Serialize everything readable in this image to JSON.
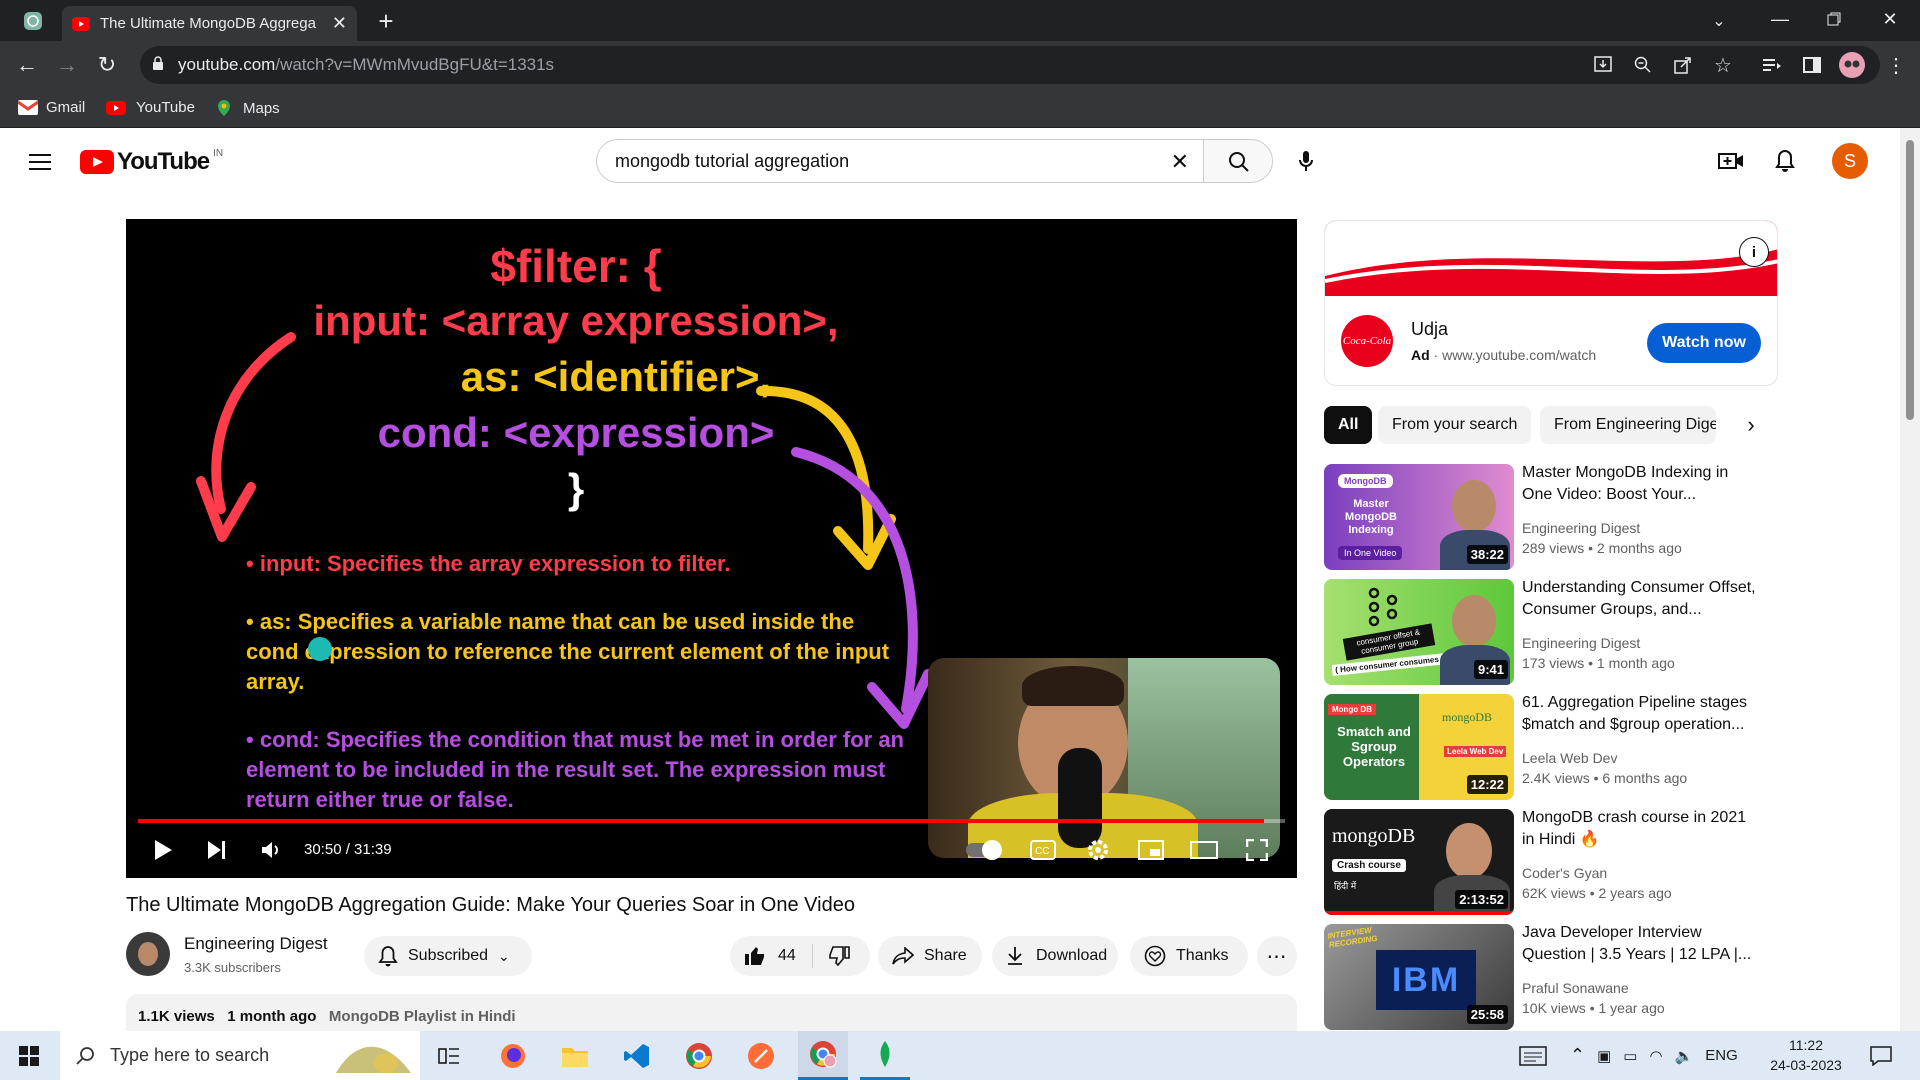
{
  "browser": {
    "tab_title": "The Ultimate MongoDB Aggrega",
    "url_host": "youtube.com",
    "url_path": "/watch?v=MWmMvudBgFU&t=1331s",
    "bookmarks": [
      "Gmail",
      "YouTube",
      "Maps"
    ]
  },
  "youtube": {
    "logo": "YouTube",
    "region": "IN",
    "search_query": "mongodb tutorial aggregation",
    "avatar_letter": "S"
  },
  "player": {
    "slide_title": "$filter: {",
    "slide_lines": [
      "input: <array expression>,",
      "as: <identifier>,",
      "cond: <expression>",
      "}"
    ],
    "bullet1": "input: Specifies the array expression to filter.",
    "bullet2": "as: Specifies a variable name that can be used inside the cond expression to reference the current element of the input array.",
    "bullet3": "cond: Specifies the condition that must be met in order for an element to be included in the result set. The expression must return either true or false.",
    "time": "30:50 / 31:39",
    "progress": 0.982
  },
  "video": {
    "title": "The Ultimate MongoDB Aggregation Guide: Make Your Queries Soar in One Video",
    "channel": "Engineering Digest",
    "subscribers": "3.3K subscribers",
    "subscribed_label": "Subscribed",
    "likes": "44",
    "share": "Share",
    "download": "Download",
    "thanks": "Thanks",
    "views": "1.1K views",
    "age": "1 month ago",
    "playlist": "MongoDB Playlist in Hindi"
  },
  "ad": {
    "name": "Udja",
    "ad_label": "Ad",
    "url": "www.youtube.com/watch",
    "cta": "Watch now",
    "brand": "Coca-Cola"
  },
  "chips": [
    "All",
    "From your search",
    "From Engineering Dige"
  ],
  "recommendations": [
    {
      "title": "Master MongoDB Indexing in One Video: Boost Your...",
      "channel": "Engineering Digest",
      "meta": "289 views • 2 months ago",
      "duration": "38:22",
      "thumb_text": "Master MongoDB Indexing",
      "thumb_sub": "In One Video",
      "thumb_tag": "MongoDB"
    },
    {
      "title": "Understanding Consumer Offset, Consumer Groups, and...",
      "channel": "Engineering Digest",
      "meta": "173 views • 1 month ago",
      "duration": "9:41",
      "thumb_text": "consumer offset & consumer group",
      "thumb_sub": "( How consumer consumes )"
    },
    {
      "title": "61. Aggregation Pipeline stages $match and $group operation...",
      "channel": "Leela Web Dev",
      "meta": "2.4K views • 6 months ago",
      "duration": "12:22",
      "thumb_text": "Smatch and Sgroup Operators",
      "thumb_tag": "Mongo DB",
      "thumb_sub": "mongoDB",
      "thumb_badge": "Leela Web Dev"
    },
    {
      "title": "MongoDB crash course in 2021 in Hindi 🔥",
      "channel": "Coder's Gyan",
      "meta": "62K views • 2 years ago",
      "duration": "2:13:52",
      "thumb_text": "mongoDB",
      "thumb_sub": "Crash course",
      "thumb_tag": "हिंदी में"
    },
    {
      "title": "Java Developer Interview Question | 3.5 Years | 12 LPA |...",
      "channel": "Praful Sonawane",
      "meta": "10K views • 1 year ago",
      "duration": "25:58",
      "thumb_text": "IBM",
      "thumb_tag": "INTERVIEW RECORDING"
    }
  ],
  "taskbar": {
    "search_placeholder": "Type here to search",
    "lang": "ENG",
    "time": "11:22",
    "date": "24-03-2023"
  },
  "colors": {
    "yt_red": "#ff0000",
    "cta_blue": "#065fd4",
    "avatar_orange": "#e65c00",
    "slide_red": "#ff3c4b",
    "slide_yellow": "#f5c518",
    "slide_purple": "#b44fe0"
  }
}
